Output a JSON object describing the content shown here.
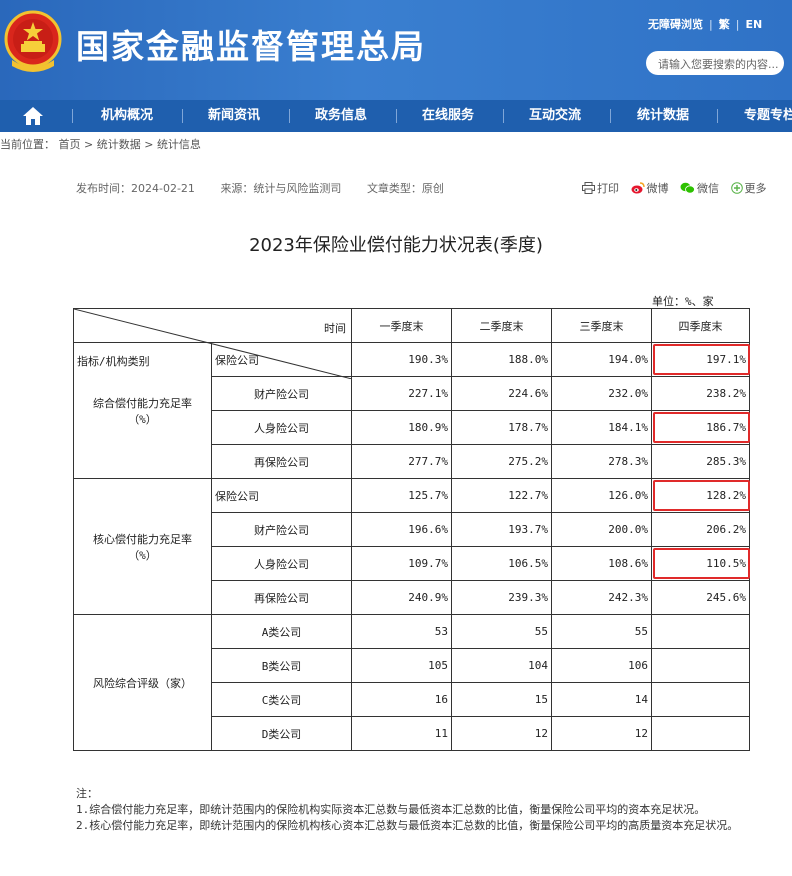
{
  "header": {
    "site_title": "国家金融监督管理总局",
    "top_links": [
      "无障碍浏览",
      "繁",
      "EN"
    ],
    "search_placeholder": "请输入您要搜索的内容..."
  },
  "nav": {
    "items": [
      "机构概况",
      "新闻资讯",
      "政务信息",
      "在线服务",
      "互动交流",
      "统计数据",
      "专题专栏"
    ]
  },
  "breadcrumb": {
    "prefix": "当前位置：",
    "items": [
      "首页",
      "统计数据",
      "统计信息"
    ],
    "separator": ">"
  },
  "meta": {
    "publish": "发布时间：2024-02-21",
    "source": "来源：统计与风险监测司",
    "type": "文章类型：原创"
  },
  "share": [
    "打印",
    "微博",
    "微信",
    "更多"
  ],
  "article": {
    "title": "2023年保险业偿付能力状况表(季度)",
    "unit": "单位：%、家"
  },
  "table": {
    "diag_top": "时间",
    "diag_bottom": "指标/机构类别",
    "quarters": [
      "一季度末",
      "二季度末",
      "三季度末",
      "四季度末"
    ],
    "groups": [
      {
        "label": "综合偿付能力充足率",
        "unit": "（%）",
        "rows": [
          {
            "name": "保险公司",
            "values": [
              "190.3%",
              "188.0%",
              "194.0%",
              "197.1%"
            ]
          },
          {
            "name": "财产险公司",
            "values": [
              "227.1%",
              "224.6%",
              "232.0%",
              "238.2%"
            ]
          },
          {
            "name": "人身险公司",
            "values": [
              "180.9%",
              "178.7%",
              "184.1%",
              "186.7%"
            ]
          },
          {
            "name": "再保险公司",
            "values": [
              "277.7%",
              "275.2%",
              "278.3%",
              "285.3%"
            ]
          }
        ]
      },
      {
        "label": "核心偿付能力充足率",
        "unit": "（%）",
        "rows": [
          {
            "name": "保险公司",
            "values": [
              "125.7%",
              "122.7%",
              "126.0%",
              "128.2%"
            ]
          },
          {
            "name": "财产险公司",
            "values": [
              "196.6%",
              "193.7%",
              "200.0%",
              "206.2%"
            ]
          },
          {
            "name": "人身险公司",
            "values": [
              "109.7%",
              "106.5%",
              "108.6%",
              "110.5%"
            ]
          },
          {
            "name": "再保险公司",
            "values": [
              "240.9%",
              "239.3%",
              "242.3%",
              "245.6%"
            ]
          }
        ]
      },
      {
        "label": "风险综合评级（家）",
        "unit": "",
        "rows": [
          {
            "name": "A类公司",
            "values": [
              "53",
              "55",
              "55",
              ""
            ]
          },
          {
            "name": "B类公司",
            "values": [
              "105",
              "104",
              "106",
              ""
            ]
          },
          {
            "name": "C类公司",
            "values": [
              "16",
              "15",
              "14",
              ""
            ]
          },
          {
            "name": "D类公司",
            "values": [
              "11",
              "12",
              "12",
              ""
            ]
          }
        ]
      }
    ]
  },
  "notes": {
    "title": "注：",
    "items": [
      "1.综合偿付能力充足率，即统计范围内的保险机构实际资本汇总数与最低资本汇总数的比值，衡量保险公司平均的资本充足状况。",
      "2.核心偿付能力充足率，即统计范围内的保险机构核心资本汇总数与最低资本汇总数的比值，衡量保险公司平均的高质量资本充足状况。"
    ]
  },
  "colors": {
    "header": "#2d6fc1",
    "nav": "#1f5fae",
    "highlight": "#e02a2a"
  },
  "icons": [
    "national-emblem",
    "home-icon",
    "print-icon",
    "weibo-icon",
    "wechat-icon",
    "more-icon"
  ]
}
